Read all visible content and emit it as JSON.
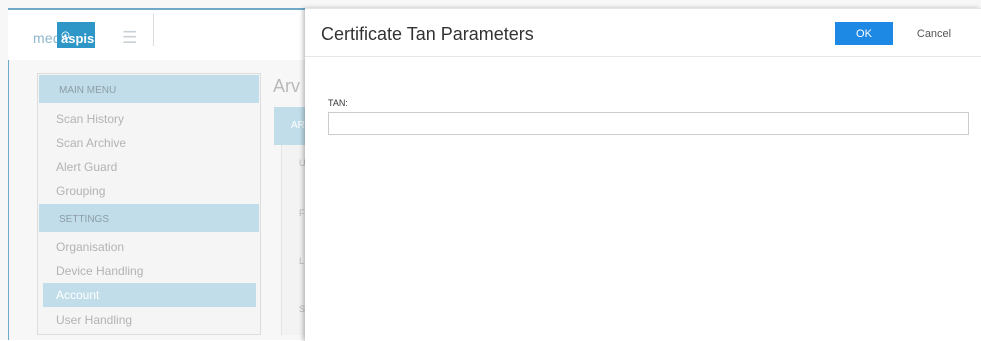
{
  "background": {
    "logo": {
      "med": "med",
      "aspis": "aspis"
    },
    "main_menu": {
      "header": "MAIN MENU",
      "items": [
        {
          "label": "Scan History"
        },
        {
          "label": "Scan Archive"
        },
        {
          "label": "Alert Guard"
        },
        {
          "label": "Grouping"
        }
      ]
    },
    "settings_menu": {
      "header": "SETTINGS",
      "items": [
        {
          "label": "Organisation"
        },
        {
          "label": "Device Handling"
        },
        {
          "label": "Account",
          "active": true
        },
        {
          "label": "User Handling"
        }
      ]
    },
    "page_heading": "Arv",
    "card_label": "AR",
    "card_letters": [
      "U",
      "F",
      "L",
      "S"
    ]
  },
  "modal": {
    "title": "Certificate Tan Parameters",
    "ok_label": "OK",
    "cancel_label": "Cancel",
    "tan": {
      "label": "TAN:",
      "value": "",
      "placeholder": ""
    }
  },
  "colors": {
    "primary_button": "#1e88e5",
    "menu_header_bg": "#c0dde9",
    "logo_blue": "#2f97c8"
  }
}
